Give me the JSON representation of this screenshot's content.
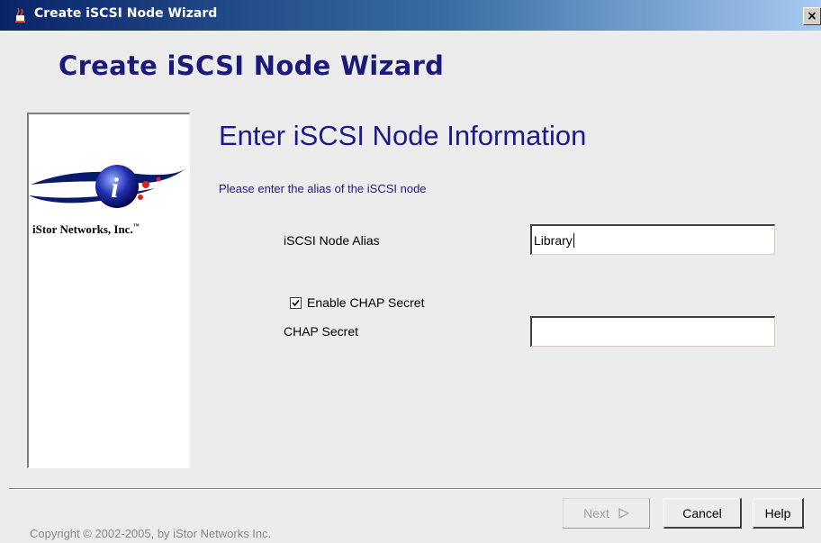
{
  "window": {
    "title": "Create iSCSI Node Wizard",
    "close_glyph": "×"
  },
  "header": {
    "title": "Create iSCSI Node Wizard"
  },
  "sidebar": {
    "brand": "iStor Networks, Inc.",
    "brand_tm": "™"
  },
  "main": {
    "heading": "Enter iSCSI Node Information",
    "instruction": "Please enter the alias of the iSCSI node",
    "alias_label": "iSCSI Node Alias",
    "alias_value": "Library",
    "enable_chap_label": "Enable CHAP Secret",
    "enable_chap_checked": true,
    "chap_label": "CHAP Secret",
    "chap_value": ""
  },
  "footer": {
    "copyright": "Copyright © 2002-2005, by iStor Networks Inc.",
    "next_label": "Next",
    "next_icon": "triangle-right-icon",
    "cancel_label": "Cancel",
    "help_label": "Help"
  },
  "colors": {
    "title_bar_start": "#0a246a",
    "heading_blue": "#1a1a8a",
    "window_bg": "#ececec"
  }
}
